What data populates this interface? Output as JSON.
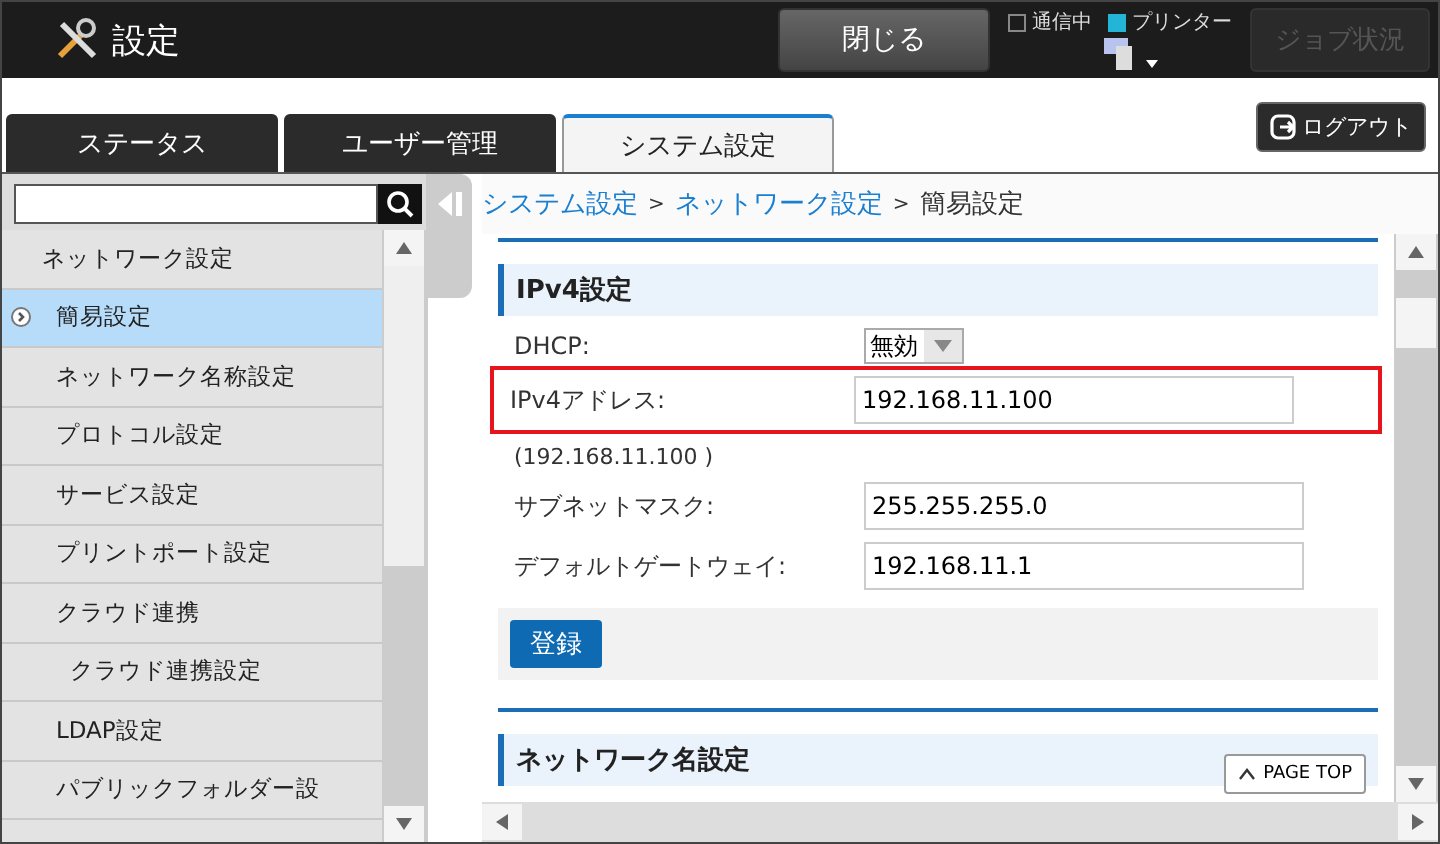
{
  "header": {
    "title": "設定",
    "close_button": "閉じる",
    "indicators": [
      {
        "label": "通信中",
        "lit": false
      },
      {
        "label": "プリンター",
        "lit": true
      }
    ],
    "job_button": {
      "label": "ジョブ状況",
      "disabled": true
    }
  },
  "tabs": [
    {
      "label": "ステータス",
      "selected": false
    },
    {
      "label": "ユーザー管理",
      "selected": false
    },
    {
      "label": "システム設定",
      "selected": true
    }
  ],
  "logout_button": "ログアウト",
  "sidebar": {
    "items": [
      {
        "label": "ネットワーク設定",
        "selected": false,
        "children": [
          {
            "label": "簡易設定",
            "selected": true
          },
          {
            "label": "ネットワーク名称設定",
            "selected": false
          },
          {
            "label": "プロトコル設定",
            "selected": false
          },
          {
            "label": "サービス設定",
            "selected": false
          },
          {
            "label": "プリントポート設定",
            "selected": false
          },
          {
            "label": "クラウド連携",
            "selected": false,
            "children": [
              {
                "label": "クラウド連携設定",
                "selected": false
              }
            ]
          },
          {
            "label": "LDAP設定",
            "selected": false
          },
          {
            "label": "パブリックフォルダー設",
            "selected": false
          }
        ]
      }
    ]
  },
  "breadcrumb": [
    {
      "label": "システム設定",
      "link": true,
      "separator": ">"
    },
    {
      "label": "ネットワーク設定",
      "link": true,
      "separator": ">"
    },
    {
      "label": "簡易設定",
      "link": false
    }
  ],
  "section": {
    "title": "IPv4設定",
    "dhcp": {
      "label": "DHCP:",
      "value": "無効"
    },
    "fields": [
      {
        "label": "IPv4アドレス:",
        "value": "192.168.11.100",
        "highlighted": true,
        "note": "(192.168.11.100 )"
      },
      {
        "label": "サブネットマスク:",
        "value": "255.255.255.0",
        "highlighted": false
      },
      {
        "label": "デフォルトゲートウェイ:",
        "value": "192.168.11.1",
        "highlighted": false
      }
    ],
    "submit": "登録"
  },
  "next_section": {
    "title": "ネットワーク名設定"
  },
  "page_top": "PAGE TOP"
}
